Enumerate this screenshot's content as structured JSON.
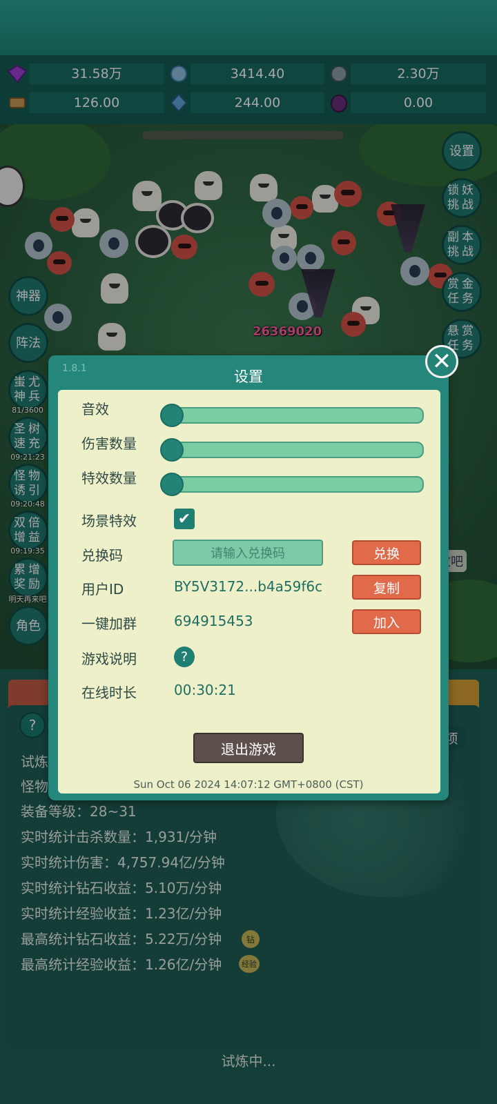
{
  "resources": [
    {
      "icon": "purple-gem-icon",
      "value": "31.58万"
    },
    {
      "icon": "blue-crystal-icon",
      "value": "3414.40"
    },
    {
      "icon": "gray-orb-icon",
      "value": "2.30万"
    },
    {
      "icon": "scroll-icon",
      "value": "126.00"
    },
    {
      "icon": "ice-shard-icon",
      "value": "244.00"
    },
    {
      "icon": "purple-egg-icon",
      "value": "0.00"
    }
  ],
  "battle": {
    "damage_popup": "26369020"
  },
  "right_buttons": {
    "settings": "设置",
    "lock_demon": "锁妖挑战",
    "dungeon": "副本挑战",
    "gold_task": "赏金任务",
    "bounty_task": "悬赏任务"
  },
  "left_buttons": {
    "artifact": "神器",
    "formation": "阵法",
    "chiyou": "蚩尤神兵",
    "chiyou_progress": "81/3600",
    "tree": "圣树速充",
    "tree_timer": "09:21:23",
    "lure": "怪物诱引",
    "lure_timer": "09:20:48",
    "double": "双倍增益",
    "double_timer": "09:19:35",
    "reward": "累增奖励",
    "reward_hint": "明天再来吧",
    "role": "角色"
  },
  "side_tags": {
    "right_mid": "败吧",
    "tab_right": "项"
  },
  "info": {
    "lines": [
      "试炼",
      "怪物",
      "装备等级：28~31",
      "实时统计击杀数量：1,931/分钟",
      "实时统计伤害：4,757.94亿/分钟",
      "实时统计钻石收益：5.10万/分钟",
      "实时统计经验收益：1.23亿/分钟",
      "最高统计钻石收益：5.22万/分钟",
      "最高统计经验收益：1.26亿/分钟"
    ],
    "badge_diamond": "钻",
    "badge_exp": "经验",
    "status": "试炼中..."
  },
  "dialog": {
    "version": "1.8.1",
    "title": "设置",
    "sound_label": "音效",
    "damage_label": "伤害数量",
    "effect_label": "特效数量",
    "scene_label": "场景特效",
    "scene_enabled": true,
    "code_label": "兑换码",
    "code_placeholder": "请输入兑换码",
    "redeem_btn": "兑换",
    "uid_label": "用户ID",
    "uid_value": "BY5V3172...b4a59f6c",
    "copy_btn": "复制",
    "group_label": "一键加群",
    "group_value": "694915453",
    "join_btn": "加入",
    "help_label": "游戏说明",
    "help_icon": "?",
    "online_label": "在线时长",
    "online_value": "00:30:21",
    "exit_btn": "退出游戏",
    "timestamp": "Sun Oct 06 2024 14:07:12 GMT+0800 (CST)",
    "sliders": {
      "sound": 0,
      "damage": 0,
      "effect": 0
    }
  }
}
